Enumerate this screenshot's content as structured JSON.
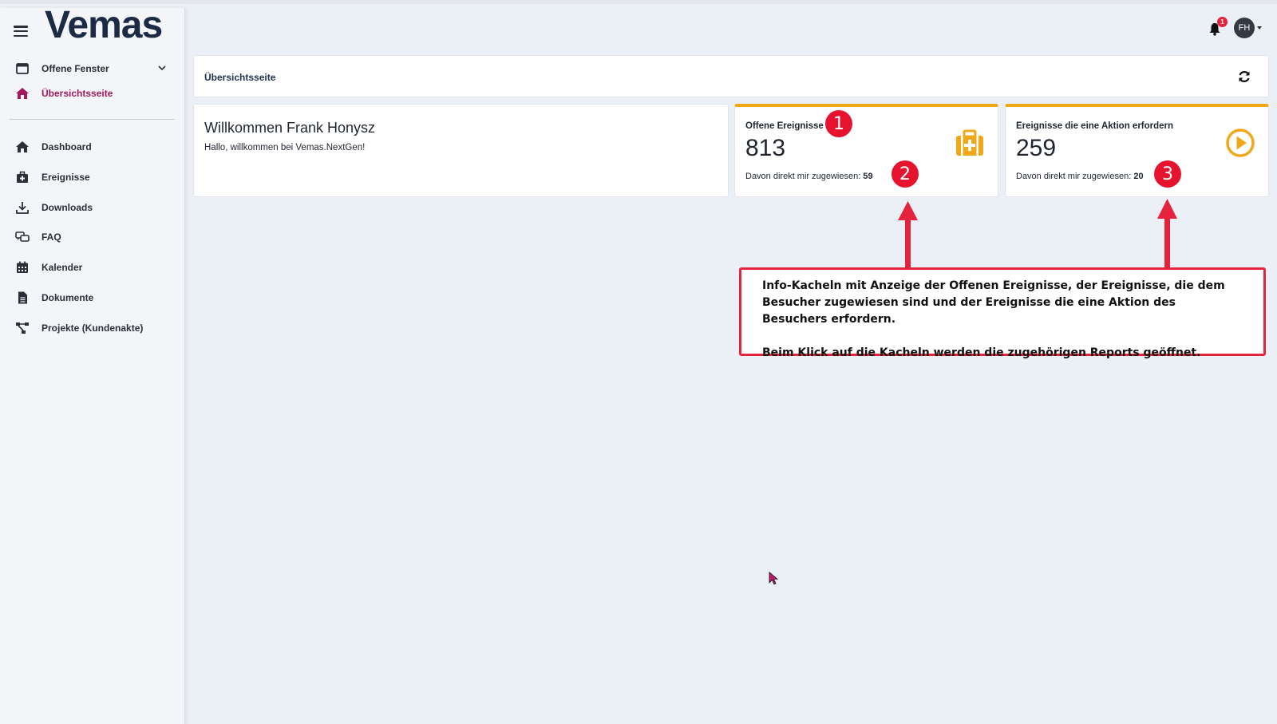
{
  "app": {
    "logo": "Vemas"
  },
  "sidebar": {
    "top_items": [
      {
        "label": "Offene Fenster",
        "icon": "window-icon"
      },
      {
        "label": "Übersichtsseite",
        "icon": "home-icon",
        "active": true
      }
    ],
    "items": [
      {
        "label": "Dashboard",
        "icon": "home-icon"
      },
      {
        "label": "Ereignisse",
        "icon": "medical-case-icon"
      },
      {
        "label": "Downloads",
        "icon": "download-icon"
      },
      {
        "label": "FAQ",
        "icon": "chat-icon"
      },
      {
        "label": "Kalender",
        "icon": "calendar-icon"
      },
      {
        "label": "Dokumente",
        "icon": "document-icon"
      },
      {
        "label": "Projekte (Kundenakte)",
        "icon": "network-icon"
      }
    ]
  },
  "header": {
    "notification_count": "1",
    "user_initials": "FH"
  },
  "breadcrumb": {
    "title": "Übersichtsseite"
  },
  "welcome": {
    "title": "Willkommen Frank Honysz",
    "subtitle": "Hallo, willkommen bei Vemas.NextGen!"
  },
  "tiles": [
    {
      "title": "Offene Ereignisse",
      "value": "813",
      "sub_label": "Davon direkt mir zugewiesen:",
      "sub_value": "59",
      "icon": "medical-case-icon"
    },
    {
      "title": "Ereignisse die eine Aktion erfordern",
      "value": "259",
      "sub_label": "Davon direkt mir zugewiesen:",
      "sub_value": "20",
      "icon": "play-circle-icon"
    }
  ],
  "annotation": {
    "markers": [
      "1",
      "2",
      "3"
    ],
    "line1": "Info-Kacheln mit Anzeige der Offenen Ereignisse, der Ereignisse, die dem Besucher zugewiesen sind und der Ereignisse die eine Aktion des Besuchers erfordern.",
    "line2": "Beim Klick auf die Kacheln werden die zugehörigen Reports geöffnet."
  },
  "colors": {
    "accent": "#a3185a",
    "tile_border": "#f0a81b",
    "annotation_red": "#e5233d",
    "logo": "#1c2a44"
  }
}
